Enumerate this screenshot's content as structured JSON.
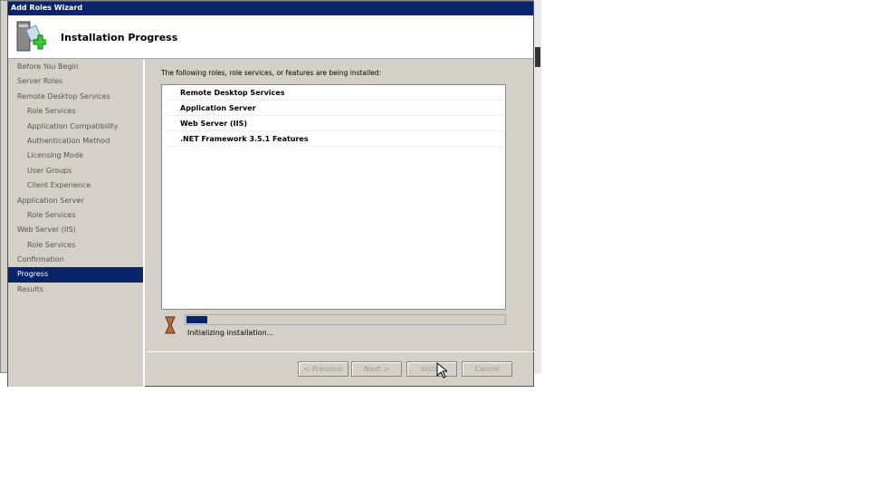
{
  "window": {
    "title": "Add Roles Wizard",
    "page_title": "Installation Progress"
  },
  "sidebar": {
    "items": [
      {
        "label": "Before You Begin",
        "sub": false
      },
      {
        "label": "Server Roles",
        "sub": false
      },
      {
        "label": "Remote Desktop Services",
        "sub": false
      },
      {
        "label": "Role Services",
        "sub": true
      },
      {
        "label": "Application Compatibility",
        "sub": true
      },
      {
        "label": "Authentication Method",
        "sub": true
      },
      {
        "label": "Licensing Mode",
        "sub": true
      },
      {
        "label": "User Groups",
        "sub": true
      },
      {
        "label": "Client Experience",
        "sub": true
      },
      {
        "label": "Application Server",
        "sub": false
      },
      {
        "label": "Role Services",
        "sub": true
      },
      {
        "label": "Web Server (IIS)",
        "sub": false
      },
      {
        "label": "Role Services",
        "sub": true
      },
      {
        "label": "Confirmation",
        "sub": false
      },
      {
        "label": "Progress",
        "sub": false,
        "active": true
      },
      {
        "label": "Results",
        "sub": false
      }
    ]
  },
  "main": {
    "intro": "The following roles, role services, or features are being installed:",
    "items": [
      "Remote Desktop Services",
      "Application Server",
      "Web Server (IIS)",
      ".NET Framework 3.5.1 Features"
    ],
    "progress_percent": 7,
    "status": "Initializing installation..."
  },
  "buttons": {
    "previous": "< Previous",
    "next": "Next >",
    "install": "Install",
    "cancel": "Cancel"
  },
  "colors": {
    "accent": "#0a246a"
  }
}
